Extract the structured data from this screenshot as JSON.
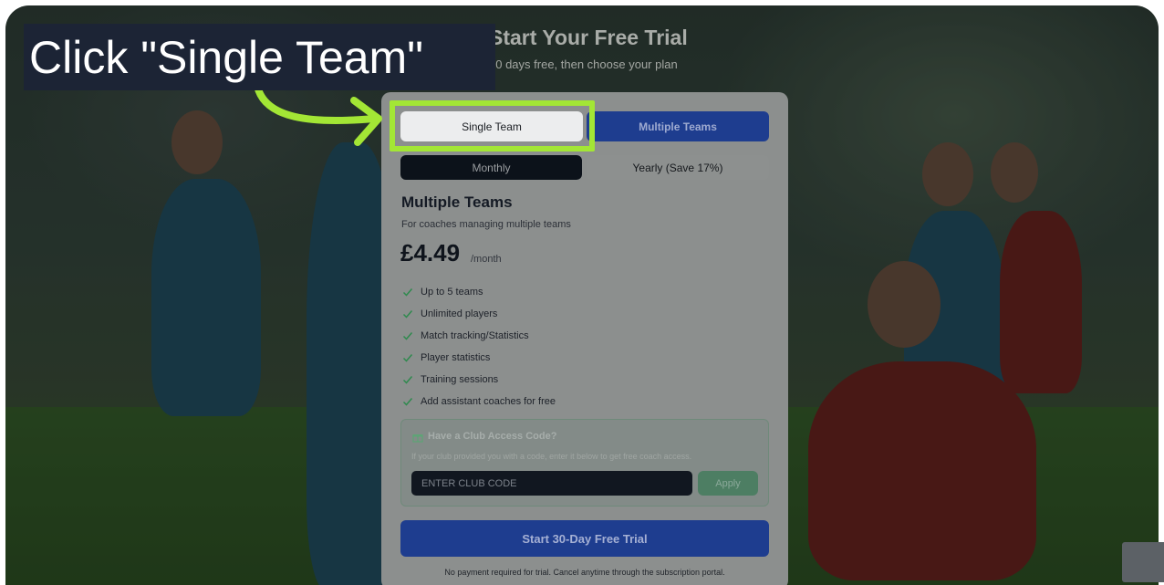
{
  "header": {
    "title": "Start Your Free Trial",
    "subtitle": "30 days free, then choose your plan"
  },
  "plan_toggle": {
    "single_label": "Single Team",
    "multiple_label": "Multiple Teams",
    "selected": "Multiple Teams"
  },
  "billing_toggle": {
    "monthly_label": "Monthly",
    "yearly_label": "Yearly (Save 17%)",
    "selected": "Monthly"
  },
  "plan": {
    "title": "Multiple Teams",
    "description": "For coaches managing multiple teams",
    "price": "£4.49",
    "period": "/month",
    "features": [
      "Up to 5 teams",
      "Unlimited players",
      "Match tracking/Statistics",
      "Player statistics",
      "Training sessions",
      "Add assistant coaches for free"
    ]
  },
  "club_access": {
    "title": "Have a Club Access Code?",
    "help": "If your club provided you with a code, enter it below to get free coach access.",
    "input_placeholder": "ENTER CLUB CODE",
    "input_value": "",
    "apply_label": "Apply"
  },
  "cta": {
    "label": "Start 30-Day Free Trial",
    "footnote": "No payment required for trial. Cancel anytime through the subscription portal."
  },
  "instruction": {
    "text": "Click \"Single Team\""
  },
  "colors": {
    "highlight": "#a3e635",
    "primary": "#1e3d8f",
    "check": "#2f8a4e"
  },
  "icons": {
    "feature": "check-icon",
    "club": "gift-icon",
    "annotation": "curved-arrow-icon"
  }
}
